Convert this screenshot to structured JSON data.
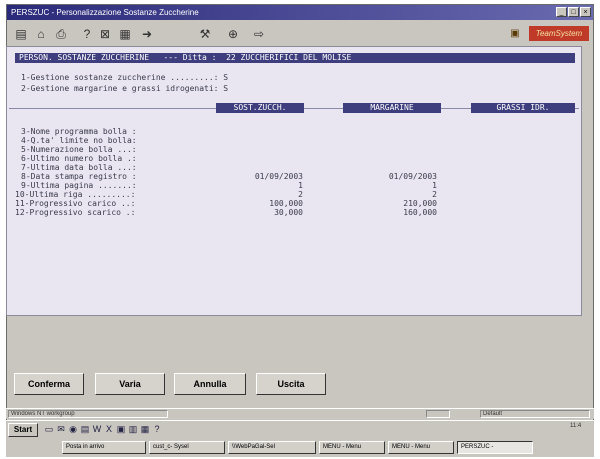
{
  "window": {
    "title": "PERSZUC - Personalizzazione Sostanze Zuccherine"
  },
  "screen": {
    "header": "PERSON. SOSTANZE ZUCCHERINE   --- Ditta :  22 ZUCCHERIFICI DEL MOLISE",
    "menu": [
      "1-Gestione sostanze zuccherine .........: S",
      "2-Gestione margarine e grassi idrogenati: S"
    ],
    "columns": [
      "SOST.ZUCCH.",
      "MARGARINE",
      "GRASSI IDR."
    ],
    "fields": [
      {
        "label": "3-Nome programma bolla :",
        "v1": "",
        "v2": ""
      },
      {
        "label": "4-Q.ta' limite no bolla:",
        "v1": "",
        "v2": ""
      },
      {
        "label": "5-Numerazione bolla ...:",
        "v1": "",
        "v2": ""
      },
      {
        "label": "6-Ultimo numero bolla .:",
        "v1": "",
        "v2": ""
      },
      {
        "label": "7-Ultima data bolla ...:",
        "v1": "",
        "v2": ""
      },
      {
        "label": "8-Data stampa registro :",
        "v1": "01/09/2003",
        "v2": "01/09/2003"
      },
      {
        "label": "9-Ultima pagina .......:",
        "v1": "1",
        "v2": "1"
      },
      {
        "label": "10-Ultima riga .........:",
        "v1": "2",
        "v2": "2"
      },
      {
        "label": "11-Progressivo carico ..:",
        "v1": "100,000",
        "v2": "210,000"
      },
      {
        "label": "12-Progressivo scarico .:",
        "v1": "30,000",
        "v2": "160,000"
      }
    ]
  },
  "buttons": {
    "confirm": "Conferma",
    "vary": "Varia",
    "cancel": "Annulla",
    "exit": "Uscita"
  },
  "statusbar": {
    "left": "Windows NT workgroup",
    "right": "Default"
  },
  "taskbar": {
    "start": "Start",
    "tasks": [
      "Posta in arrivo",
      "cust_c- Sysel",
      "\\\\WebPaGal-Sel",
      "MENU - Menu",
      "MENU - Menu",
      "PERSZUC -"
    ],
    "clock": "11:4"
  },
  "brand": {
    "text": "TeamSystem"
  },
  "icons": [
    "menu-icon",
    "home-icon",
    "print-icon",
    "help-icon",
    "calc-icon",
    "grid-icon",
    "run-icon",
    "tools-icon",
    "web-icon",
    "exit-icon",
    "dict-icon"
  ]
}
